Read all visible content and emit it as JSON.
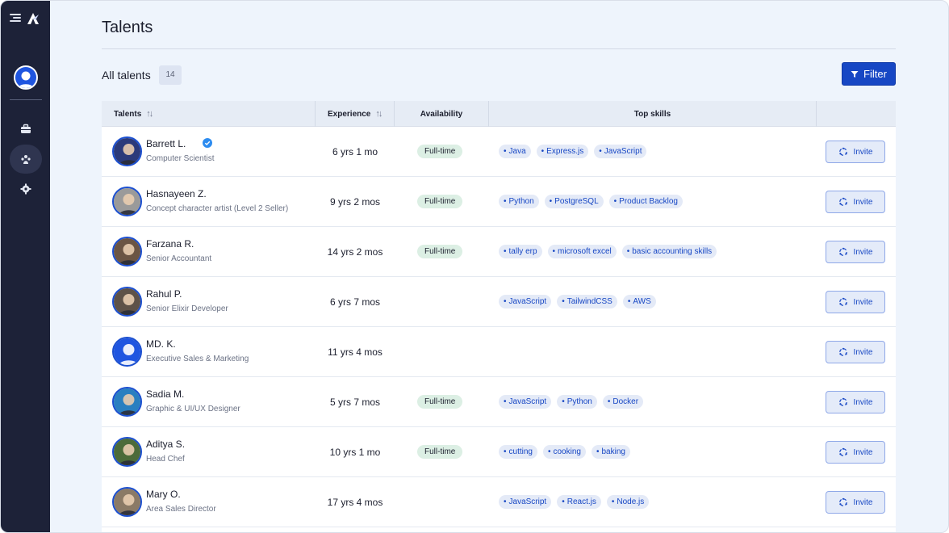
{
  "page": {
    "title": "Talents"
  },
  "list": {
    "label": "All talents",
    "count": "14"
  },
  "filter": {
    "label": "Filter"
  },
  "columns": {
    "talents": "Talents",
    "experience": "Experience",
    "availability": "Availability",
    "top_skills": "Top skills"
  },
  "invite_label": "Invite",
  "talents": [
    {
      "name": "Barrett L.",
      "role": "Computer Scientist",
      "experience": "6 yrs 1 mo",
      "availability": "Full-time",
      "skills": [
        "Java",
        "Express.js",
        "JavaScript"
      ],
      "verified": true,
      "avatar_color": "#2b3a7a"
    },
    {
      "name": "Hasnayeen Z.",
      "role": "Concept character artist (Level 2 Seller)",
      "experience": "9 yrs 2 mos",
      "availability": "Full-time",
      "skills": [
        "Python",
        "PostgreSQL",
        "Product Backlog"
      ],
      "verified": false,
      "avatar_color": "#9a9a9a"
    },
    {
      "name": "Farzana R.",
      "role": "Senior Accountant",
      "experience": "14 yrs 2 mos",
      "availability": "Full-time",
      "skills": [
        "tally erp",
        "microsoft excel",
        "basic accounting skills"
      ],
      "verified": false,
      "avatar_color": "#6b5544"
    },
    {
      "name": "Rahul P.",
      "role": "Senior Elixir Developer",
      "experience": "6 yrs 7 mos",
      "availability": "",
      "skills": [
        "JavaScript",
        "TailwindCSS",
        "AWS"
      ],
      "verified": false,
      "avatar_color": "#5e5248"
    },
    {
      "name": "MD. K.",
      "role": "Executive Sales & Marketing",
      "experience": "11 yrs 4 mos",
      "availability": "",
      "skills": [],
      "verified": false,
      "avatar_color": "#1f55e0"
    },
    {
      "name": "Sadia M.",
      "role": "Graphic & UI/UX Designer",
      "experience": "5 yrs 7 mos",
      "availability": "Full-time",
      "skills": [
        "JavaScript",
        "Python",
        "Docker"
      ],
      "verified": false,
      "avatar_color": "#2a7fc0"
    },
    {
      "name": "Aditya S.",
      "role": "Head Chef",
      "experience": "10 yrs 1 mo",
      "availability": "Full-time",
      "skills": [
        "cutting",
        "cooking",
        "baking"
      ],
      "verified": false,
      "avatar_color": "#4c6b3a"
    },
    {
      "name": "Mary O.",
      "role": "Area Sales Director",
      "experience": "17 yrs 4 mos",
      "availability": "",
      "skills": [
        "JavaScript",
        "React.js",
        "Node.js"
      ],
      "verified": false,
      "avatar_color": "#8b7a66"
    }
  ],
  "colors": {
    "sidebar": "#1d2238",
    "accent": "#1747c4",
    "background": "#eef4fc",
    "availability_chip": "#dcefe4"
  },
  "icons": {
    "sidebar": [
      "menu-icon",
      "logo-icon",
      "briefcase-icon",
      "people-icon",
      "gear-icon"
    ],
    "filter": "funnel-icon",
    "invite": "invite-icon",
    "verified": "verified-badge-icon"
  }
}
